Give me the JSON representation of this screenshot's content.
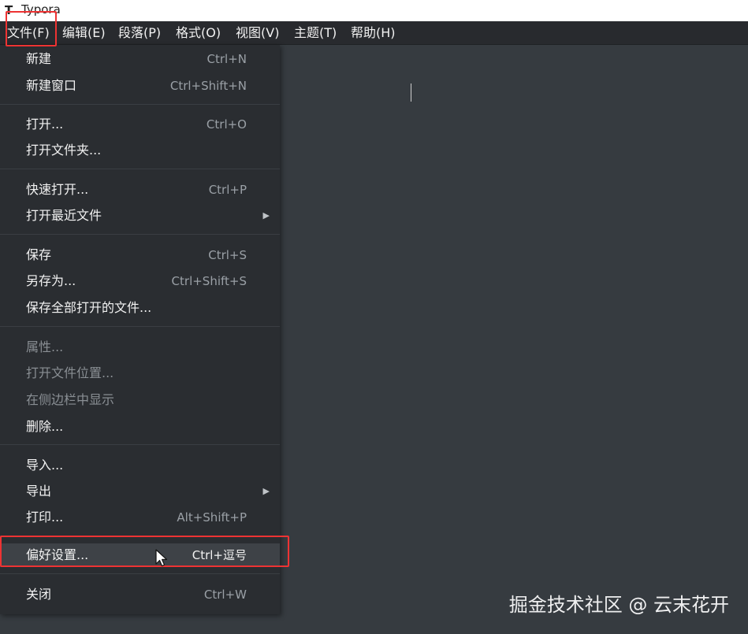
{
  "window": {
    "app_icon": "T",
    "title": "Typora"
  },
  "menubar": {
    "items": [
      "文件(F)",
      "编辑(E)",
      "段落(P)",
      "格式(O)",
      "视图(V)",
      "主题(T)",
      "帮助(H)"
    ]
  },
  "file_menu": {
    "items": [
      {
        "label": "新建",
        "shortcut": "Ctrl+N"
      },
      {
        "label": "新建窗口",
        "shortcut": "Ctrl+Shift+N"
      },
      {
        "label": "打开...",
        "shortcut": "Ctrl+O"
      },
      {
        "label": "打开文件夹...",
        "shortcut": ""
      },
      {
        "label": "快速打开...",
        "shortcut": "Ctrl+P"
      },
      {
        "label": "打开最近文件",
        "shortcut": ""
      },
      {
        "label": "保存",
        "shortcut": "Ctrl+S"
      },
      {
        "label": "另存为...",
        "shortcut": "Ctrl+Shift+S"
      },
      {
        "label": "保存全部打开的文件...",
        "shortcut": ""
      },
      {
        "label": "属性...",
        "shortcut": ""
      },
      {
        "label": "打开文件位置...",
        "shortcut": ""
      },
      {
        "label": "在侧边栏中显示",
        "shortcut": ""
      },
      {
        "label": "删除...",
        "shortcut": ""
      },
      {
        "label": "导入...",
        "shortcut": ""
      },
      {
        "label": "导出",
        "shortcut": ""
      },
      {
        "label": "打印...",
        "shortcut": "Alt+Shift+P"
      },
      {
        "label": "偏好设置...",
        "shortcut": "Ctrl+逗号"
      },
      {
        "label": "关闭",
        "shortcut": "Ctrl+W"
      }
    ]
  },
  "watermark": "掘金技术社区 @ 云末花开",
  "colors": {
    "highlight_box": "#e33333",
    "editor_bg": "#363b40",
    "menu_bg": "#2a2d31"
  }
}
